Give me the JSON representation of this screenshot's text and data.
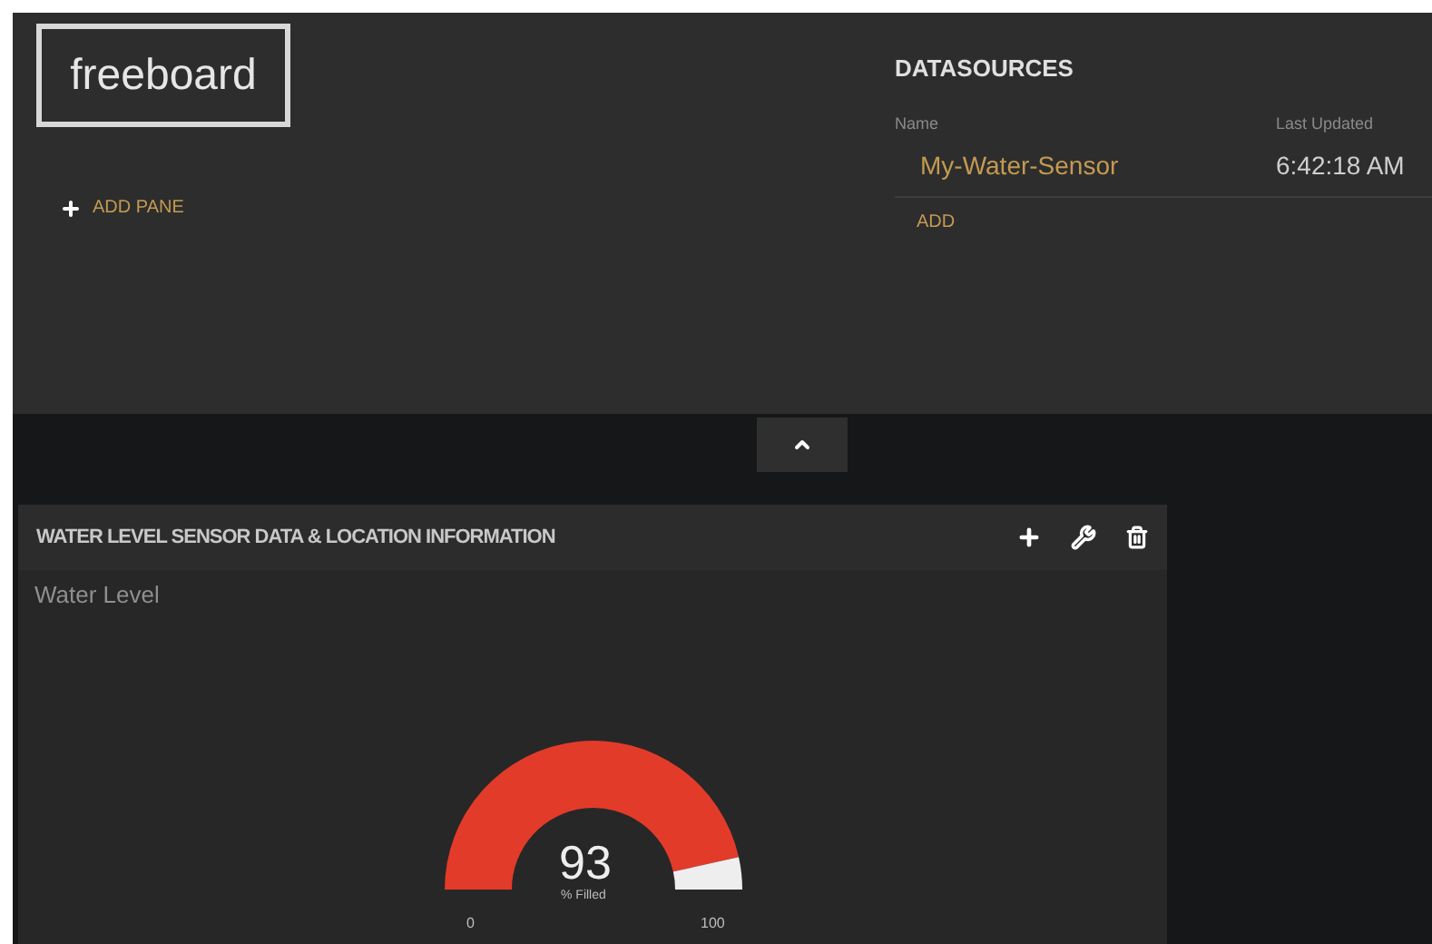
{
  "logo": "freeboard",
  "add_pane": {
    "label": "ADD PANE"
  },
  "datasources": {
    "title": "DATASOURCES",
    "columns": [
      "Name",
      "Last Updated"
    ],
    "rows": [
      {
        "name": "My-Water-Sensor",
        "last_updated": "6:42:18 AM"
      }
    ],
    "add": "ADD"
  },
  "pane": {
    "title": "WATER LEVEL SENSOR DATA & LOCATION INFORMATION",
    "widget": {
      "title": "Water Level",
      "value": "93",
      "units": "% Filled",
      "min": "0",
      "max": "100"
    }
  }
}
